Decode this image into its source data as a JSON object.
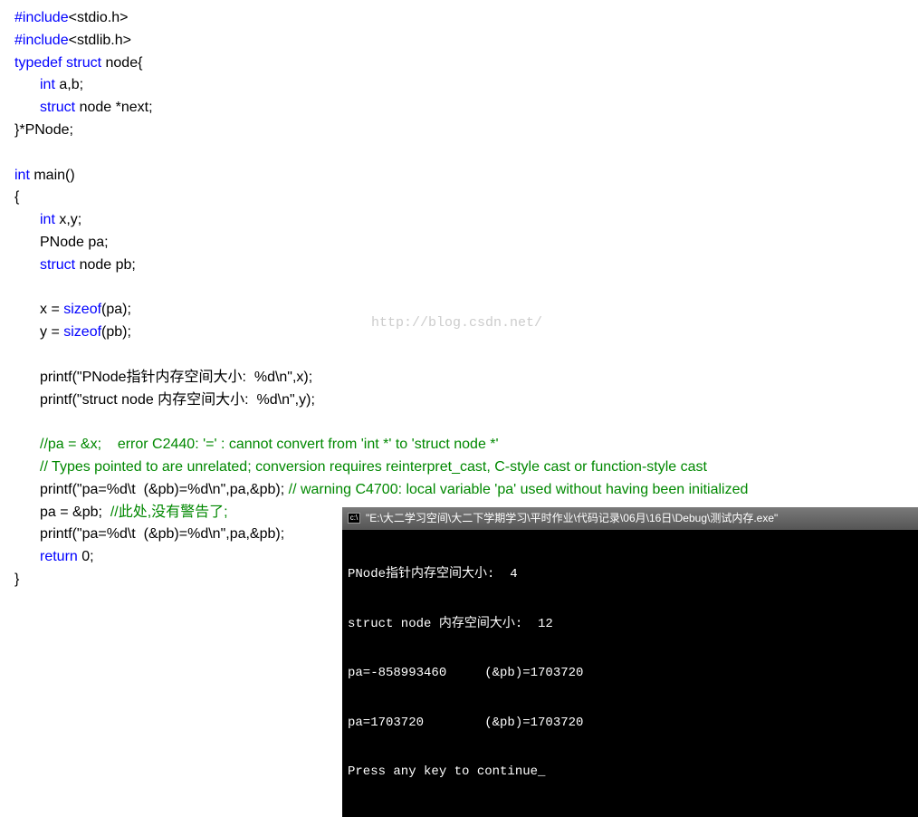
{
  "watermark": "http://blog.csdn.net/",
  "code": {
    "line1_preproc": "#include",
    "line1_header": "<stdio.h>",
    "line2_preproc": "#include",
    "line2_header": "<stdlib.h>",
    "line3_typedef": "typedef",
    "line3_struct": "struct",
    "line3_rest": " node{",
    "line4_int": "int",
    "line4_rest": " a,b;",
    "line5_struct": "struct",
    "line5_rest": " node *next;",
    "line6": "}*PNode;",
    "line8_int": "int",
    "line8_rest": " main()",
    "line9": "{",
    "line10_int": "int",
    "line10_rest": " x,y;",
    "line11": "PNode pa;",
    "line12_struct": "struct",
    "line12_rest": " node pb;",
    "line14_x": "x = ",
    "line14_sizeof": "sizeof",
    "line14_rest": "(pa);",
    "line15_y": "y = ",
    "line15_sizeof": "sizeof",
    "line15_rest": "(pb);",
    "line17_printf": "printf(\"PNode指针内存空间大小:  %d\\n\",x);",
    "line18_printf": "printf(\"struct node 内存空间大小:  %d\\n\",y);",
    "line20_comment": "//pa = &x;    error C2440: '=' : cannot convert from 'int *' to 'struct node *'",
    "line21_comment": "// Types pointed to are unrelated; conversion requires reinterpret_cast, C-style cast or function-style cast",
    "line22_printf": "printf(\"pa=%d\\t  (&pb)=%d\\n\",pa,&pb); ",
    "line22_comment": "// warning C4700: local variable 'pa' used without having been initialized",
    "line23_code": "pa = &pb;  ",
    "line23_comment": "//此处,没有警告了;",
    "line24_printf": "printf(\"pa=%d\\t  (&pb)=%d\\n\",pa,&pb);",
    "line25_return": "return",
    "line25_rest": " 0;",
    "line26": "}"
  },
  "console": {
    "title": "\"E:\\大二学习空间\\大二下学期学习\\平时作业\\代码记录\\06月\\16日\\Debug\\测试内存.exe\"",
    "lines": [
      "PNode指针内存空间大小:  4",
      "struct node 内存空间大小:  12",
      "pa=-858993460     (&pb)=1703720",
      "pa=1703720        (&pb)=1703720",
      "Press any key to continue_"
    ]
  }
}
